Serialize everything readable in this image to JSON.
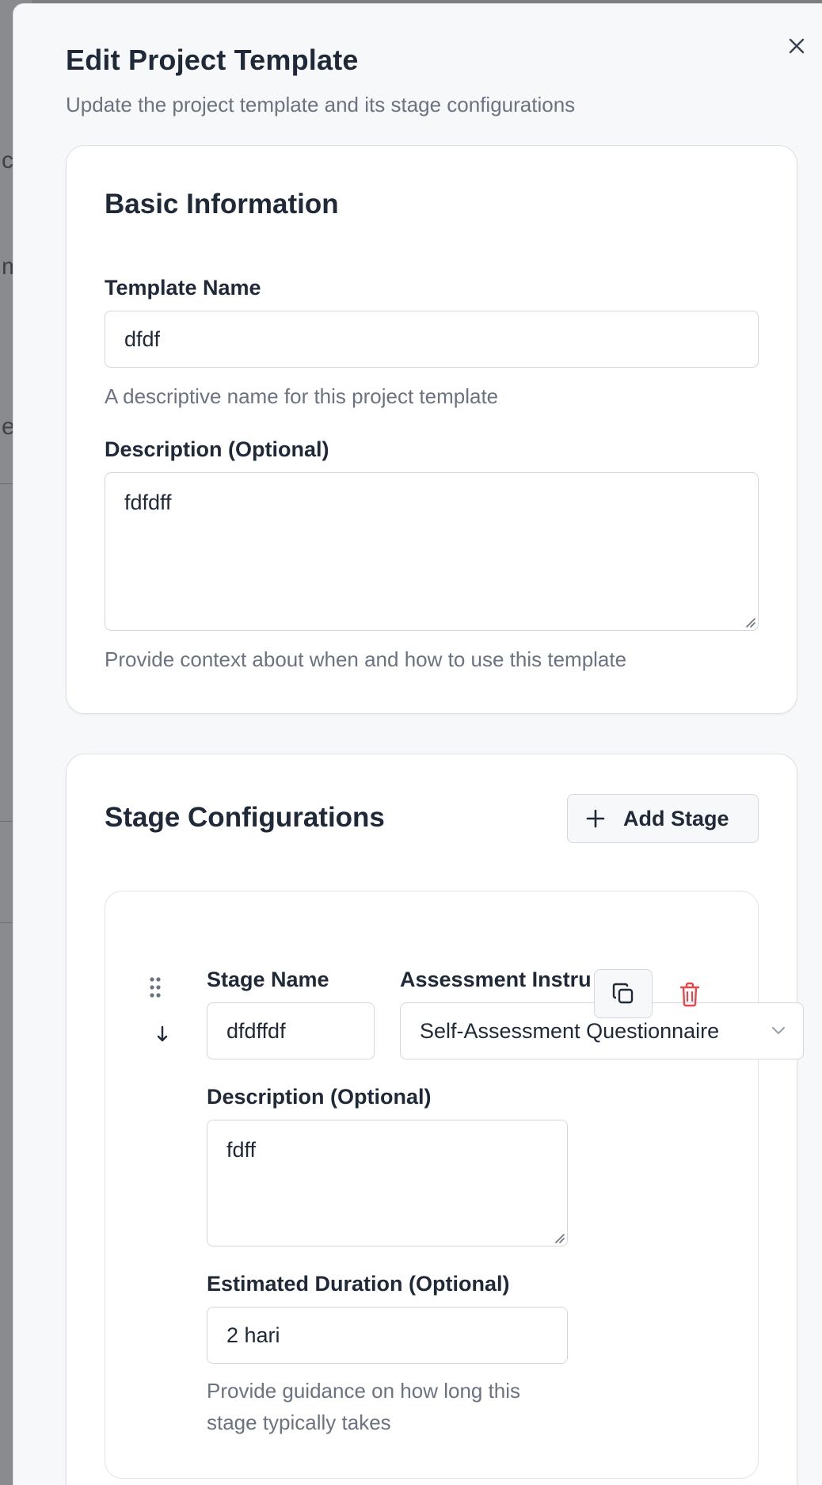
{
  "background": {
    "fragments": [
      "c",
      "m",
      "er"
    ]
  },
  "modal": {
    "title": "Edit Project Template",
    "subtitle": "Update the project template and its stage configurations",
    "close_icon": "close-icon"
  },
  "basic_info": {
    "title": "Basic Information",
    "template_name_label": "Template Name",
    "template_name_value": "dfdf",
    "template_name_help": "A descriptive name for this project template",
    "description_label": "Description (Optional)",
    "description_value": "fdfdff",
    "description_help": "Provide context about when and how to use this template"
  },
  "stages": {
    "title": "Stage Configurations",
    "add_button_label": "Add Stage",
    "items": [
      {
        "stage_name_label": "Stage Name",
        "stage_name_value": "dfdffdf",
        "instrument_label": "Assessment Instru",
        "instrument_value": "Self-Assessment Questionnaire",
        "description_label": "Description (Optional)",
        "description_value": "fdff",
        "duration_label": "Estimated Duration (Optional)",
        "duration_value": "2 hari",
        "duration_help": "Provide guidance on how long this stage typically takes"
      }
    ]
  },
  "colors": {
    "delete_red": "#e5484d",
    "text_primary": "#1f2937",
    "text_muted": "#6b7280"
  }
}
